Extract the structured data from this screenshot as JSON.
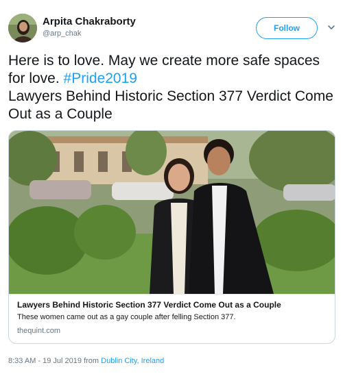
{
  "user": {
    "display_name": "Arpita Chakraborty",
    "handle": "@arp_chak"
  },
  "follow_button": {
    "label": "Follow"
  },
  "tweet": {
    "text_line1": "Here is to love. May we create more safe spaces for love. ",
    "hashtag": "#Pride2019",
    "text_line2": "Lawyers Behind Historic Section 377 Verdict Come Out as a Couple"
  },
  "card": {
    "title": "Lawyers Behind Historic Section 377 Verdict Come Out as a Couple",
    "description": "These women came out as a gay couple after felling Section 377.",
    "domain": "thequint.com"
  },
  "footer": {
    "time_date": "8:33 AM - 19 Jul 2019",
    "from_word": "from",
    "location": "Dublin City, Ireland"
  },
  "icons": {
    "avatar": "profile-photo",
    "more": "chevron-down-icon"
  },
  "colors": {
    "accent": "#1da1f2",
    "text": "#14171a",
    "muted": "#657786",
    "border": "#ccd6dd"
  }
}
